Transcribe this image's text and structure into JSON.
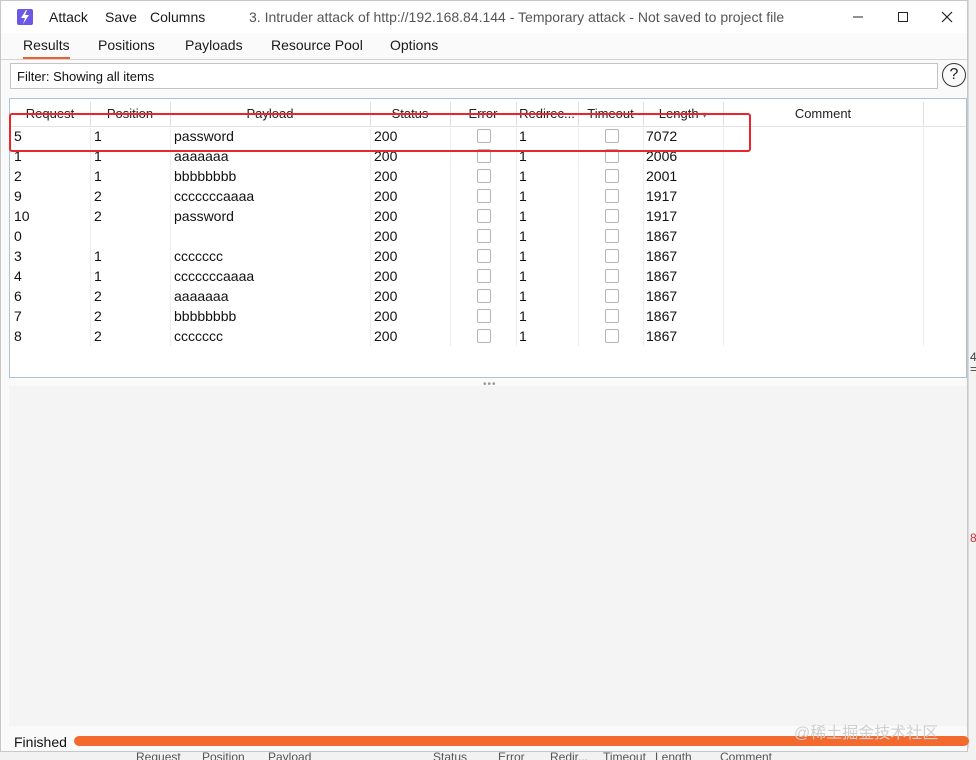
{
  "titlebar": {
    "menu": [
      "Attack",
      "Save",
      "Columns"
    ],
    "title": "3. Intruder attack of http://192.168.84.144 - Temporary attack - Not saved to project file",
    "app_icon": "lightning-icon",
    "controls": [
      "minimize-icon",
      "maximize-icon",
      "close-icon"
    ]
  },
  "tabs": [
    "Results",
    "Positions",
    "Payloads",
    "Resource Pool",
    "Options"
  ],
  "active_tab": "Results",
  "filter": {
    "text": "Filter: Showing all items",
    "help": "?"
  },
  "table": {
    "columns": [
      "Request",
      "Position",
      "Payload",
      "Status",
      "Error",
      "Redirec...",
      "Timeout",
      "Length",
      "Comment"
    ],
    "sort_indicator": "▾",
    "rows": [
      {
        "request": "5",
        "position": "1",
        "payload": "password",
        "status": "200",
        "error": false,
        "redirects": "1",
        "timeout": false,
        "length": "7072"
      },
      {
        "request": "1",
        "position": "1",
        "payload": "aaaaaaa",
        "status": "200",
        "error": false,
        "redirects": "1",
        "timeout": false,
        "length": "2006"
      },
      {
        "request": "2",
        "position": "1",
        "payload": "bbbbbbbb",
        "status": "200",
        "error": false,
        "redirects": "1",
        "timeout": false,
        "length": "2001"
      },
      {
        "request": "9",
        "position": "2",
        "payload": "cccccccaaaa",
        "status": "200",
        "error": false,
        "redirects": "1",
        "timeout": false,
        "length": "1917"
      },
      {
        "request": "10",
        "position": "2",
        "payload": "password",
        "status": "200",
        "error": false,
        "redirects": "1",
        "timeout": false,
        "length": "1917"
      },
      {
        "request": "0",
        "position": "",
        "payload": "",
        "status": "200",
        "error": false,
        "redirects": "1",
        "timeout": false,
        "length": "1867"
      },
      {
        "request": "3",
        "position": "1",
        "payload": "ccccccc",
        "status": "200",
        "error": false,
        "redirects": "1",
        "timeout": false,
        "length": "1867"
      },
      {
        "request": "4",
        "position": "1",
        "payload": "cccccccaaaa",
        "status": "200",
        "error": false,
        "redirects": "1",
        "timeout": false,
        "length": "1867"
      },
      {
        "request": "6",
        "position": "2",
        "payload": "aaaaaaa",
        "status": "200",
        "error": false,
        "redirects": "1",
        "timeout": false,
        "length": "1867"
      },
      {
        "request": "7",
        "position": "2",
        "payload": "bbbbbbbb",
        "status": "200",
        "error": false,
        "redirects": "1",
        "timeout": false,
        "length": "1867"
      },
      {
        "request": "8",
        "position": "2",
        "payload": "ccccccc",
        "status": "200",
        "error": false,
        "redirects": "1",
        "timeout": false,
        "length": "1867"
      }
    ]
  },
  "status": {
    "label": "Finished",
    "progress": 1.0
  },
  "watermark": "@稀土掘金技术社区",
  "background_window": {
    "right_edge_fragments": [
      "4",
      "=",
      "8"
    ],
    "bottom_columns": [
      "Request",
      "Position",
      "Payload",
      "Status",
      "Error",
      "Redir...",
      "Timeout",
      "Length",
      "Comment"
    ]
  },
  "colors": {
    "accent": "#e8602c",
    "highlight_box": "#e8262b",
    "progress": "#f26a2e",
    "app_icon": "#6b57e8"
  }
}
